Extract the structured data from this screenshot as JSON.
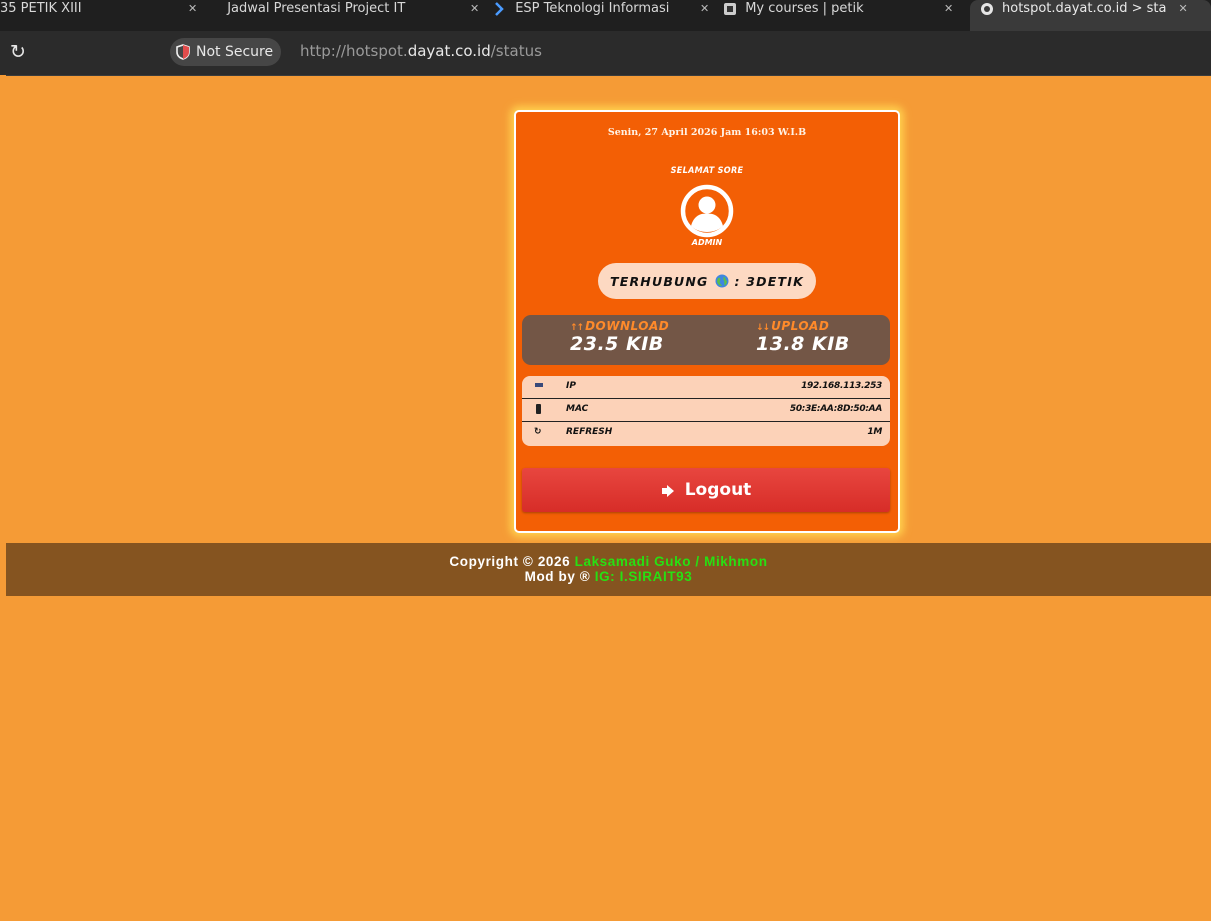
{
  "browser": {
    "tabs": [
      {
        "title": "35 PETIK XIII",
        "active": false
      },
      {
        "title": "Jadwal Presentasi Project IT",
        "active": false
      },
      {
        "title": "ESP Teknologi Informasi",
        "active": false
      },
      {
        "title": "My courses | petik",
        "active": false
      },
      {
        "title": "hotspot.dayat.co.id > sta",
        "active": true
      }
    ],
    "security_label": "Not Secure",
    "url_prefix": "http://hotspot.",
    "url_domain": "dayat.co.id",
    "url_path": "/status"
  },
  "status_card": {
    "datetime": "Senin, 27 April 2026 Jam 16:03 W.I.B",
    "greeting": "SELAMAT SORE",
    "username": "ADMIN",
    "connection_label": "TERHUBUNG",
    "connection_sep": ": 3DETIK",
    "download_label": "DOWNLOAD",
    "download_value": "23.5 KIB",
    "upload_label": "UPLOAD",
    "upload_value": "13.8 KIB",
    "info_rows": [
      {
        "icon": "monitor-icon",
        "label": "IP",
        "value": "192.168.113.253"
      },
      {
        "icon": "mobile-icon",
        "label": "MAC",
        "value": "50:3E:AA:8D:50:AA"
      },
      {
        "icon": "refresh-icon",
        "label": "REFRESH",
        "value": "1M"
      }
    ],
    "logout_label": "Logout"
  },
  "footer": {
    "line1_prefix": "Copyright © 2026",
    "line1_link": "Laksamadi Guko / Mikhmon",
    "line2_prefix": "Mod by ®",
    "line2_link": "IG: I.SIRAIT93"
  },
  "colors": {
    "page_bg": "#f59b36",
    "card_bg": "#f35f05",
    "footer_bg": "#855420",
    "link_green": "#27e012",
    "logout_red": "#dd3630"
  }
}
